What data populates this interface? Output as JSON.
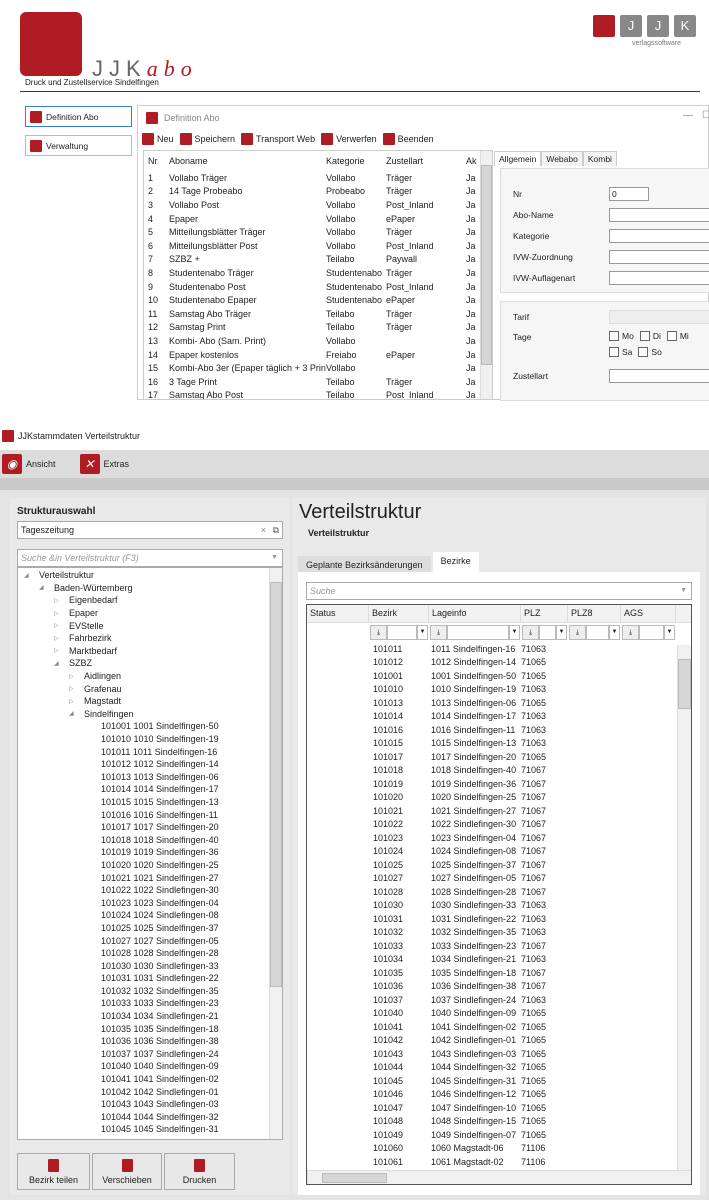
{
  "header": {
    "brand_main": "JJK",
    "brand_suffix": "abo",
    "subtitle": "Druck und  Zustellservice Sindelfingen",
    "vendor_letters": [
      "J",
      "J",
      "K"
    ],
    "vendor_label": "verlagssoftware",
    "accent": "#b01c24"
  },
  "nav": [
    {
      "label": "Definition Abo",
      "icon": "abo-icon"
    },
    {
      "label": "Verwaltung",
      "icon": "admin-icon"
    }
  ],
  "abo_window": {
    "title": "Definition Abo",
    "toolbar": [
      "Neu",
      "Speichern",
      "Transport Web",
      "Verwerfen",
      "Beenden"
    ],
    "columns": [
      "Nr",
      "Aboname",
      "Kategorie",
      "Zustellart",
      "Ak"
    ],
    "rows": [
      [
        "1",
        "Vollabo Träger",
        "Vollabo",
        "Träger",
        "Ja"
      ],
      [
        "2",
        "14 Tage Probeabo",
        "Probeabo",
        "Träger",
        "Ja"
      ],
      [
        "3",
        "Vollabo Post",
        "Vollabo",
        "Post_Inland",
        "Ja"
      ],
      [
        "4",
        "Epaper",
        "Vollabo",
        "ePaper",
        "Ja"
      ],
      [
        "5",
        "Mitteilungsblätter Träger",
        "Vollabo",
        "Träger",
        "Ja"
      ],
      [
        "6",
        "Mitteilungsblätter Post",
        "Vollabo",
        "Post_Inland",
        "Ja"
      ],
      [
        "7",
        "SZBZ +",
        "Teilabo",
        "Paywall",
        "Ja"
      ],
      [
        "8",
        "Studentenabo Träger",
        "Studentenabo",
        "Träger",
        "Ja"
      ],
      [
        "9",
        "Studentenabo Post",
        "Studentenabo",
        "Post_Inland",
        "Ja"
      ],
      [
        "10",
        "Studentenabo Epaper",
        "Studentenabo",
        "ePaper",
        "Ja"
      ],
      [
        "11",
        "Samstag Abo Träger",
        "Teilabo",
        "Träger",
        "Ja"
      ],
      [
        "12",
        "Samstag Print",
        "Teilabo",
        "Träger",
        "Ja"
      ],
      [
        "13",
        "Kombi- Abo (Sam. Print)",
        "Vollabo",
        "",
        "Ja"
      ],
      [
        "14",
        "Epaper kostenlos",
        "Freiabo",
        "ePaper",
        "Ja"
      ],
      [
        "15",
        "Kombi-Abo 3er (Epaper täglich + 3 Print)",
        "Vollabo",
        "",
        "Ja"
      ],
      [
        "16",
        "3 Tage Print",
        "Teilabo",
        "Träger",
        "Ja"
      ],
      [
        "17",
        "Samstag Abo Post",
        "Teilabo",
        "Post_Inland",
        "Ja"
      ]
    ],
    "tabs": [
      "Allgemein",
      "Webabo",
      "Kombi"
    ],
    "form": {
      "nr_label": "Nr",
      "nr_value": "0",
      "aboname_label": "Abo-Name",
      "kategorie_label": "Kategorie",
      "ivw_zuordnung_label": "IVW-Zuordnung",
      "ivw_auflagenart_label": "IVW-Auflagenart",
      "tarif_label": "Tarif",
      "tage_label": "Tage",
      "days": [
        "Mo",
        "Di",
        "Mi",
        "Sa",
        "So"
      ],
      "zustellart_label": "Zustellart"
    }
  },
  "vs_window": {
    "title": "JJKstammdaten Verteilstruktur",
    "toolbar": [
      "Ansicht",
      "Extras"
    ],
    "left": {
      "heading": "Strukturauswahl",
      "selector_value": "Tageszeitung",
      "search_placeholder": "Suche &in Verteilstruktur (F3)",
      "tree": [
        {
          "label": "Verteilstruktur",
          "level": 0,
          "arrow": "open"
        },
        {
          "label": "Baden-Würtemberg",
          "level": 1,
          "arrow": "open"
        },
        {
          "label": "Eigenbedarf",
          "level": 2,
          "arrow": "closed"
        },
        {
          "label": "Epaper",
          "level": 2,
          "arrow": "closed"
        },
        {
          "label": "EVStelle",
          "level": 2,
          "arrow": "closed"
        },
        {
          "label": "Fahrbezirk",
          "level": 2,
          "arrow": "closed"
        },
        {
          "label": "Marktbedarf",
          "level": 2,
          "arrow": "closed"
        },
        {
          "label": "SZBZ",
          "level": 2,
          "arrow": "open"
        },
        {
          "label": "Aidlingen",
          "level": 3,
          "arrow": "closed"
        },
        {
          "label": "Grafenau",
          "level": 3,
          "arrow": "closed"
        },
        {
          "label": "Magstadt",
          "level": 3,
          "arrow": "closed"
        },
        {
          "label": "Sindelfingen",
          "level": 3,
          "arrow": "open"
        }
      ],
      "leaves": [
        "101001 1001 Sindelfingen-50",
        "101010 1010 Sindelfingen-19",
        "101011 1011 Sindelfingen-16",
        "101012 1012 Sindelfingen-14",
        "101013 1013 Sindelfingen-06",
        "101014 1014 Sindelfingen-17",
        "101015 1015 Sindelfingen-13",
        "101016 1016 Sindelfingen-11",
        "101017 1017 Sindelfingen-20",
        "101018 1018 Sindelfingen-40",
        "101019 1019 Sindelfingen-36",
        "101020 1020 Sindelfingen-25",
        "101021 1021 Sindelfingen-27",
        "101022 1022 Sindlefingen-30",
        "101023 1023 Sindelfingen-04",
        "101024 1024 Sindlefingen-08",
        "101025 1025 Sindelfingen-37",
        "101027 1027 Sindelfingen-05",
        "101028 1028 Sindelfingen-28",
        "101030 1030 Sindlefingen-33",
        "101031 1031 Sindlefingen-22",
        "101032 1032 Sindelfingen-35",
        "101033 1033 Sindelfingen-23",
        "101034 1034 Sindlefingen-21",
        "101035 1035 Sindelfingen-18",
        "101036 1036 Sindelfingen-38",
        "101037 1037 Sindlefingen-24",
        "101040 1040 Sindelfingen-09",
        "101041 1041 Sindelfingen-02",
        "101042 1042 Sindlefingen-01",
        "101043 1043 Sindlefingen-03",
        "101044 1044 Sindelfingen-32",
        "101045 1045 Sindelfingen-31"
      ],
      "buttons": [
        "Bezirk teilen",
        "Verschieben",
        "Drucken"
      ]
    },
    "right": {
      "title": "Verteilstruktur",
      "subtitle": "Verteilstruktur",
      "tabs": [
        "Geplante Bezirksänderungen",
        "Bezirke"
      ],
      "search_placeholder": "Suche",
      "columns": [
        "Status",
        "Bezirk",
        "Lageinfo",
        "PLZ",
        "PLZ8",
        "AGS"
      ],
      "rows": [
        [
          "101011",
          "1011 Sindelfingen-16",
          "71063"
        ],
        [
          "101012",
          "1012 Sindelfingen-14",
          "71065"
        ],
        [
          "101001",
          "1001 Sindelfingen-50",
          "71065"
        ],
        [
          "101010",
          "1010 Sindelfingen-19",
          "71063"
        ],
        [
          "101013",
          "1013 Sindelfingen-06",
          "71065"
        ],
        [
          "101014",
          "1014 Sindelfingen-17",
          "71063"
        ],
        [
          "101016",
          "1016 Sindelfingen-11",
          "71063"
        ],
        [
          "101015",
          "1015 Sindelfingen-13",
          "71063"
        ],
        [
          "101017",
          "1017 Sindelfingen-20",
          "71065"
        ],
        [
          "101018",
          "1018 Sindelfingen-40",
          "71067"
        ],
        [
          "101019",
          "1019 Sindelfingen-36",
          "71067"
        ],
        [
          "101020",
          "1020 Sindelfingen-25",
          "71067"
        ],
        [
          "101021",
          "1021 Sindelfingen-27",
          "71067"
        ],
        [
          "101022",
          "1022 Sindlefingen-30",
          "71067"
        ],
        [
          "101023",
          "1023 Sindelfingen-04",
          "71067"
        ],
        [
          "101024",
          "1024 Sindlefingen-08",
          "71067"
        ],
        [
          "101025",
          "1025 Sindelfingen-37",
          "71067"
        ],
        [
          "101027",
          "1027 Sindelfingen-05",
          "71067"
        ],
        [
          "101028",
          "1028 Sindelfingen-28",
          "71067"
        ],
        [
          "101030",
          "1030 Sindlefingen-33",
          "71063"
        ],
        [
          "101031",
          "1031 Sindlefingen-22",
          "71063"
        ],
        [
          "101032",
          "1032 Sindelfingen-35",
          "71063"
        ],
        [
          "101033",
          "1033 Sindelfingen-23",
          "71067"
        ],
        [
          "101034",
          "1034 Sindlefingen-21",
          "71063"
        ],
        [
          "101035",
          "1035 Sindelfingen-18",
          "71067"
        ],
        [
          "101036",
          "1036 Sindelfingen-38",
          "71067"
        ],
        [
          "101037",
          "1037 Sindlefingen-24",
          "71063"
        ],
        [
          "101040",
          "1040 Sindelfingen-09",
          "71065"
        ],
        [
          "101041",
          "1041 Sindelfingen-02",
          "71065"
        ],
        [
          "101042",
          "1042 Sindlefingen-01",
          "71065"
        ],
        [
          "101043",
          "1043 Sindlefingen-03",
          "71065"
        ],
        [
          "101044",
          "1044 Sindelfingen-32",
          "71065"
        ],
        [
          "101045",
          "1045 Sindelfingen-31",
          "71065"
        ],
        [
          "101046",
          "1046 Sindelfingen-12",
          "71065"
        ],
        [
          "101047",
          "1047 Sindelfingen-10",
          "71065"
        ],
        [
          "101048",
          "1048 Sindelfingen-15",
          "71065"
        ],
        [
          "101049",
          "1049 Sindelfingen-07",
          "71065"
        ],
        [
          "101060",
          "1060 Magstadt-06",
          "71106"
        ],
        [
          "101061",
          "1061 Magstadt-02",
          "71106"
        ]
      ]
    }
  }
}
